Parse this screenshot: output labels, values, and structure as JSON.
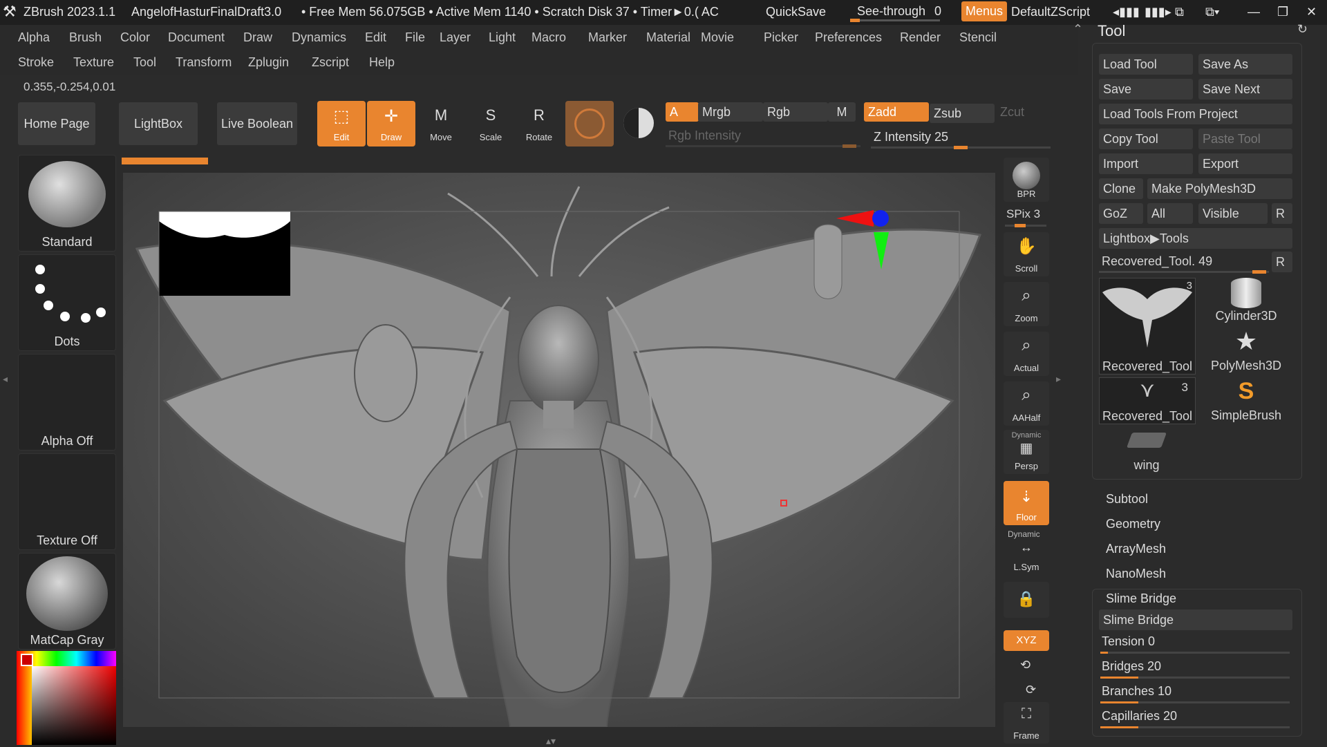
{
  "title": {
    "app": "ZBrush 2023.1.1",
    "document": "AngelofHasturFinalDraft3.0",
    "mem": "• Free Mem 56.075GB • Active Mem 1140 • Scratch Disk 37 • Timer►0.( AC",
    "quicksave": "QuickSave",
    "seethrough": "See-through",
    "seethrough_value": "0",
    "menus": "Menus",
    "script": "DefaultZScript"
  },
  "menu_row1": [
    "Alpha",
    "Brush",
    "Color",
    "Document",
    "Draw",
    "Dynamics",
    "Edit",
    "File",
    "Layer",
    "Light",
    "Macro",
    "Marker",
    "Material",
    "Movie",
    "Picker",
    "Preferences",
    "Render",
    "Stencil"
  ],
  "menu_row2": [
    "Stroke",
    "Texture",
    "Tool",
    "Transform",
    "Zplugin",
    "Zscript",
    "Help"
  ],
  "coords": "0.355,-0.254,0.01",
  "shelf": {
    "home": "Home Page",
    "lightbox": "LightBox",
    "live_boolean": "Live Boolean",
    "edit": "Edit",
    "draw": "Draw",
    "move": "Move",
    "scale": "Scale",
    "rotate": "Rotate",
    "a": "A",
    "mrgb": "Mrgb",
    "rgb": "Rgb",
    "m": "M",
    "zadd": "Zadd",
    "zsub": "Zsub",
    "zcut": "Zcut",
    "rgb_intensity": "Rgb Intensity",
    "z_intensity": "Z Intensity 25"
  },
  "left_slots": [
    "Standard",
    "Dots",
    "Alpha Off",
    "Texture Off",
    "MatCap Gray"
  ],
  "right_bar": {
    "bpr": "BPR",
    "spix": "SPix 3",
    "scroll": "Scroll",
    "zoom": "Zoom",
    "actual": "Actual",
    "aahalf": "AAHalf",
    "dynamic": "Dynamic",
    "persp": "Persp",
    "floor": "Floor",
    "dynamic2": "Dynamic",
    "lsym": "L.Sym",
    "xyz": "XYZ",
    "frame": "Frame"
  },
  "tool": {
    "header": "Tool",
    "load_tool": "Load Tool",
    "save_as": "Save As",
    "save": "Save",
    "save_next": "Save Next",
    "load_from_project": "Load Tools From Project",
    "copy_tool": "Copy Tool",
    "paste_tool": "Paste Tool",
    "import": "Import",
    "export": "Export",
    "clone": "Clone",
    "make_polymesh": "Make PolyMesh3D",
    "goz": "GoZ",
    "all": "All",
    "visible": "Visible",
    "r": "R",
    "lightbox_tools": "Lightbox▶Tools",
    "recovered_label": "Recovered_Tool. 49",
    "thumbs": [
      {
        "label": "Recovered_Tool",
        "badge": "3"
      },
      {
        "label": "Cylinder3D",
        "badge": ""
      },
      {
        "label": "PolyMesh3D",
        "badge": ""
      },
      {
        "label": "Recovered_Tool",
        "badge": "3"
      },
      {
        "label": "SimpleBrush",
        "badge": ""
      },
      {
        "label": "wing",
        "badge": ""
      }
    ],
    "sections": [
      "Subtool",
      "Geometry",
      "ArrayMesh",
      "NanoMesh"
    ],
    "slime_header": "Slime Bridge",
    "slime_button": "Slime Bridge",
    "sliders": [
      {
        "label": "Tension 0",
        "fraction": 0.03
      },
      {
        "label": "Bridges 20",
        "fraction": 0.2
      },
      {
        "label": "Branches 10",
        "fraction": 0.2
      },
      {
        "label": "Capillaries 20",
        "fraction": 0.2
      }
    ]
  }
}
